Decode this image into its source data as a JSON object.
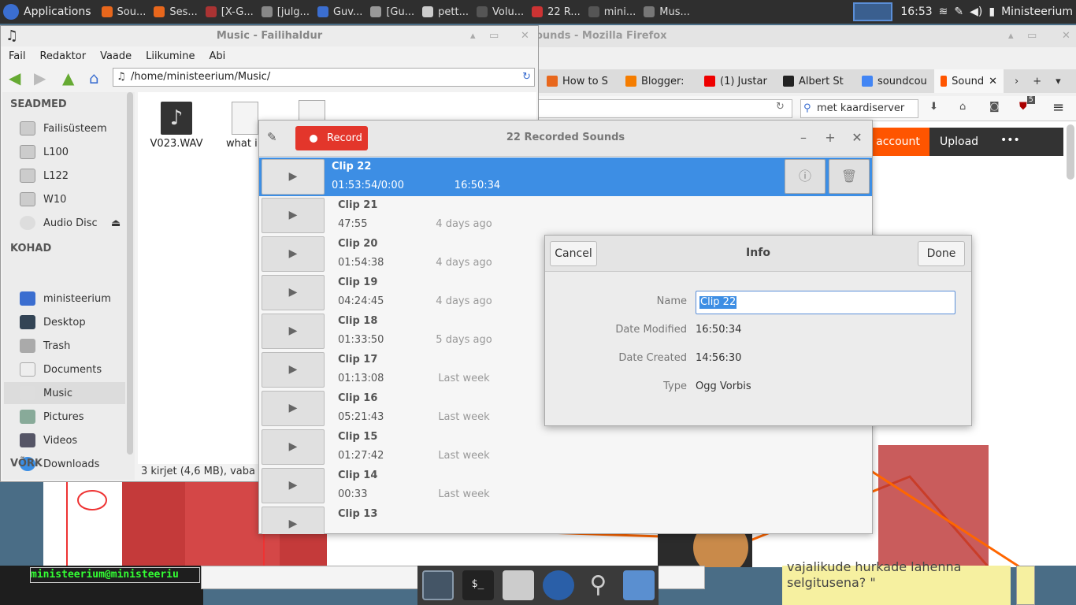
{
  "top_panel": {
    "applications": "Applications",
    "tasks": [
      "Sou...",
      "Ses...",
      "[X-G...",
      "[julg...",
      "Guv...",
      "[Gu...",
      "pett...",
      "Volu...",
      "22 R...",
      "mini...",
      "Mus..."
    ],
    "clock": "16:53",
    "user": "Ministeerium"
  },
  "firefox": {
    "title": "ounds - Mozilla Firefox",
    "tabs": [
      "How to S",
      "Blogger:",
      "(1) Justar",
      "Albert St",
      "soundcou",
      "Sound"
    ],
    "search": "met kaardiserver",
    "addon_badge": "5",
    "account": "account",
    "upload": "Upload",
    "more": "•••"
  },
  "file_manager": {
    "title": "Music - Failihaldur",
    "menu": [
      "Fail",
      "Redaktor",
      "Vaade",
      "Liikumine",
      "Abi"
    ],
    "path": "/home/ministeerium/Music/",
    "devices_header": "SEADMED",
    "devices": [
      "Failisüsteem",
      "L100",
      "L122",
      "W10",
      "Audio Disc"
    ],
    "places_header": "KOHAD",
    "places": [
      "ministeerium",
      "Desktop",
      "Trash",
      "Documents",
      "Music",
      "Pictures",
      "Videos",
      "Downloads"
    ],
    "network_header": "VÕRK",
    "files": [
      "V023.WAV",
      "what i"
    ],
    "status": "3 kirjet (4,6 MB), vaba"
  },
  "recorder": {
    "record_label": "Record",
    "title": "22 Recorded Sounds",
    "clips": [
      {
        "name": "Clip 22",
        "duration": "01:53:54/0:00",
        "date": "16:50:34"
      },
      {
        "name": "Clip 21",
        "duration": "47:55",
        "date": "4 days ago"
      },
      {
        "name": "Clip 20",
        "duration": "01:54:38",
        "date": "4 days ago"
      },
      {
        "name": "Clip 19",
        "duration": "04:24:45",
        "date": "4 days ago"
      },
      {
        "name": "Clip 18",
        "duration": "01:33:50",
        "date": "5 days ago"
      },
      {
        "name": "Clip 17",
        "duration": "01:13:08",
        "date": "Last week"
      },
      {
        "name": "Clip 16",
        "duration": "05:21:43",
        "date": "Last week"
      },
      {
        "name": "Clip 15",
        "duration": "01:27:42",
        "date": "Last week"
      },
      {
        "name": "Clip 14",
        "duration": "00:33",
        "date": "Last week"
      },
      {
        "name": "Clip 13",
        "duration": "",
        "date": ""
      }
    ]
  },
  "info_dialog": {
    "cancel": "Cancel",
    "title": "Info",
    "done": "Done",
    "name_label": "Name",
    "name_value": "Clip 22",
    "modified_label": "Date Modified",
    "modified_value": "16:50:34",
    "created_label": "Date Created",
    "created_value": "14:56:30",
    "type_label": "Type",
    "type_value": "Ogg Vorbis"
  },
  "taskbar": {
    "terminal_prompt": "ministeerium@ministeeriu",
    "note_line1": "vajalikude hurkade lahenna",
    "note_line2": "selgitusena?  \""
  }
}
